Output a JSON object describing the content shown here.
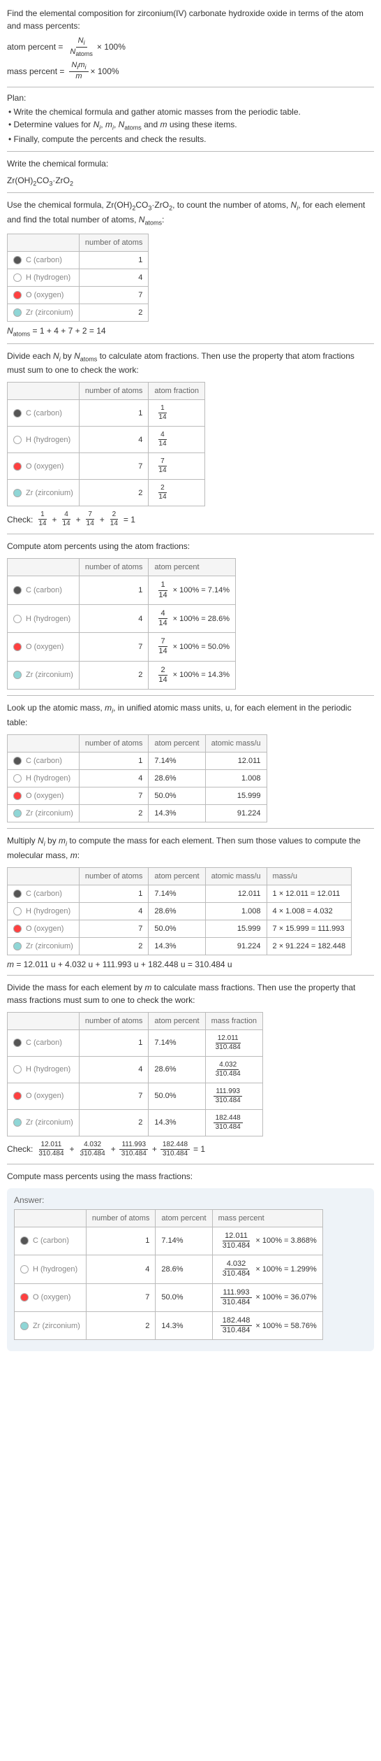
{
  "intro": "Find the elemental composition for zirconium(IV) carbonate hydroxide oxide in terms of the atom and mass percents:",
  "atom_percent_label": "atom percent =",
  "atom_percent_frac_num": "N_i",
  "atom_percent_frac_den": "N_atoms",
  "times_100": "× 100%",
  "mass_percent_label": "mass percent =",
  "mass_percent_frac_num": "N_i m_i",
  "mass_percent_frac_den": "m",
  "plan_heading": "Plan:",
  "plan_b1": "• Write the chemical formula and gather atomic masses from the periodic table.",
  "plan_b2": "• Determine values for N_i, m_i, N_atoms and m using these items.",
  "plan_b3": "• Finally, compute the percents and check the results.",
  "write_formula": "Write the chemical formula:",
  "formula": "Zr(OH)₂CO₃·ZrO₂",
  "use_formula_1": "Use the chemical formula, Zr(OH)₂CO₃·ZrO₂, to count the number of atoms, N_i, for each element and find the total number of atoms, N_atoms:",
  "elements": [
    {
      "sym": "C",
      "name": "(carbon)",
      "color": "#555555",
      "n": "1"
    },
    {
      "sym": "H",
      "name": "(hydrogen)",
      "color": "#ffffff",
      "n": "4"
    },
    {
      "sym": "O",
      "name": "(oxygen)",
      "color": "#ff4040",
      "n": "7"
    },
    {
      "sym": "Zr",
      "name": "(zirconium)",
      "color": "#8fd6d6",
      "n": "2"
    }
  ],
  "natoms_eq": "N_atoms = 1 + 4 + 7 + 2 = 14",
  "divide_text": "Divide each N_i by N_atoms to calculate atom fractions. Then use the property that atom fractions must sum to one to check the work:",
  "hdr_noa": "number of atoms",
  "hdr_af": "atom fraction",
  "hdr_ap": "atom percent",
  "hdr_am": "atomic mass/u",
  "hdr_mu": "mass/u",
  "hdr_mf": "mass fraction",
  "hdr_mp": "mass percent",
  "fractions": [
    {
      "num": "1",
      "den": "14"
    },
    {
      "num": "4",
      "den": "14"
    },
    {
      "num": "7",
      "den": "14"
    },
    {
      "num": "2",
      "den": "14"
    }
  ],
  "check1": "Check: ",
  "check1_tail": " = 1",
  "compute_ap": "Compute atom percents using the atom fractions:",
  "ap_rows": [
    {
      "frac_num": "1",
      "frac_den": "14",
      "result": "× 100% = 7.14%"
    },
    {
      "frac_num": "4",
      "frac_den": "14",
      "result": "× 100% = 28.6%"
    },
    {
      "frac_num": "7",
      "frac_den": "14",
      "result": "× 100% = 50.0%"
    },
    {
      "frac_num": "2",
      "frac_den": "14",
      "result": "× 100% = 14.3%"
    }
  ],
  "lookup_text": "Look up the atomic mass, m_i, in unified atomic mass units, u, for each element in the periodic table:",
  "mass_rows": [
    {
      "ap": "7.14%",
      "am": "12.011"
    },
    {
      "ap": "28.6%",
      "am": "1.008"
    },
    {
      "ap": "50.0%",
      "am": "15.999"
    },
    {
      "ap": "14.3%",
      "am": "91.224"
    }
  ],
  "multiply_text": "Multiply N_i by m_i to compute the mass for each element. Then sum those values to compute the molecular mass, m:",
  "mu_rows": [
    {
      "calc": "1 × 12.011 = 12.011"
    },
    {
      "calc": "4 × 1.008 = 4.032"
    },
    {
      "calc": "7 × 15.999 = 111.993"
    },
    {
      "calc": "2 × 91.224 = 182.448"
    }
  ],
  "m_eq": "m = 12.011 u + 4.032 u + 111.993 u + 182.448 u = 310.484 u",
  "divide_mass_text": "Divide the mass for each element by m to calculate mass fractions. Then use the property that mass fractions must sum to one to check the work:",
  "mf_rows": [
    {
      "num": "12.011",
      "den": "310.484"
    },
    {
      "num": "4.032",
      "den": "310.484"
    },
    {
      "num": "111.993",
      "den": "310.484"
    },
    {
      "num": "182.448",
      "den": "310.484"
    }
  ],
  "check2": "Check: ",
  "check2_tail": " = 1",
  "compute_mp": "Compute mass percents using the mass fractions:",
  "answer_label": "Answer:",
  "mp_rows": [
    {
      "ap": "7.14%",
      "num": "12.011",
      "den": "310.484",
      "result": "× 100% = 3.868%"
    },
    {
      "ap": "28.6%",
      "num": "4.032",
      "den": "310.484",
      "result": "× 100% = 1.299%"
    },
    {
      "ap": "50.0%",
      "num": "111.993",
      "den": "310.484",
      "result": "× 100% = 36.07%"
    },
    {
      "ap": "14.3%",
      "num": "182.448",
      "den": "310.484",
      "result": "× 100% = 58.76%"
    }
  ]
}
